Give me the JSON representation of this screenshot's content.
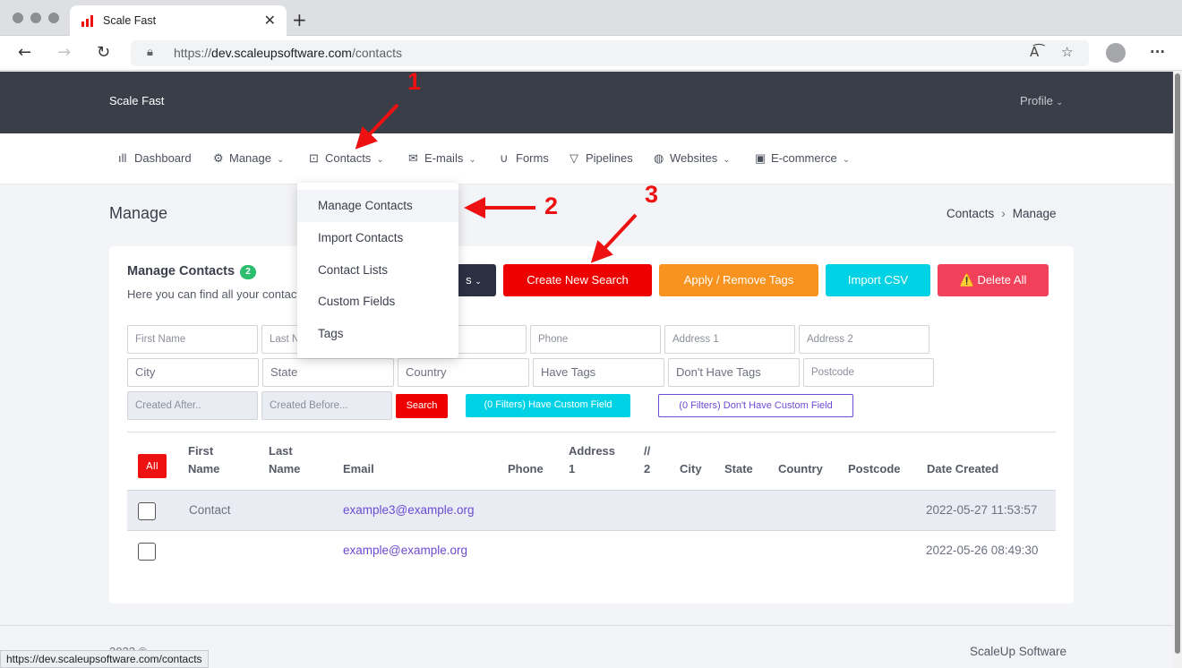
{
  "browser": {
    "tab_title": "Scale Fast",
    "url_prefix": "https://",
    "url_domain": "dev.scaleupsoftware.com",
    "url_path": "/contacts",
    "status_url": "https://dev.scaleupsoftware.com/contacts"
  },
  "header": {
    "brand": "Scale Fast",
    "profile": "Profile"
  },
  "menu": [
    {
      "label": "Dashboard",
      "icon": "bar-chart-icon"
    },
    {
      "label": "Manage",
      "icon": "gear-icon"
    },
    {
      "label": "Contacts",
      "icon": "contact-card-icon"
    },
    {
      "label": "E-mails",
      "icon": "envelope-icon"
    },
    {
      "label": "Forms",
      "icon": "magnet-icon"
    },
    {
      "label": "Pipelines",
      "icon": "funnel-icon"
    },
    {
      "label": "Websites",
      "icon": "globe-icon"
    },
    {
      "label": "E-commerce",
      "icon": "mail-box-icon"
    }
  ],
  "dropdown": [
    "Manage Contacts",
    "Import Contacts",
    "Contact Lists",
    "Custom Fields",
    "Tags"
  ],
  "page": {
    "title": "Manage",
    "breadcrumb_1": "Contacts",
    "breadcrumb_2": "Manage"
  },
  "card": {
    "title": "Manage Contacts",
    "badge": "2",
    "subtitle": "Here you can find all your contacts",
    "btn_partial": "s",
    "btn_create": "Create New Search",
    "btn_tags": "Apply / Remove Tags",
    "btn_import": "Import CSV",
    "btn_delete": "Delete All"
  },
  "filters": {
    "first_name": "First Name",
    "last_name": "Last N",
    "phone": "Phone",
    "address1": "Address 1",
    "address2": "Address 2",
    "city": "City",
    "state": "State",
    "country": "Country",
    "have_tags": "Have Tags",
    "dont_have_tags": "Don't Have Tags",
    "postcode": "Postcode",
    "created_after": "Created After..",
    "created_before": "Created Before...",
    "search": "Search",
    "have_custom": "(0 Filters) Have Custom Field",
    "dont_have_custom": "(0 Filters) Don't Have Custom Field"
  },
  "table": {
    "all": "All",
    "headers": {
      "first_a": "First",
      "first_b": "Name",
      "last_a": "Last",
      "last_b": "Name",
      "email": "Email",
      "phone": "Phone",
      "addr_a": "Address",
      "addr_b": "1",
      "addr2_a": "//",
      "addr2_b": "2",
      "city": "City",
      "state": "State",
      "country": "Country",
      "postcode": "Postcode",
      "date": "Date Created"
    },
    "rows": [
      {
        "first": "Contact",
        "email": "example3@example.org",
        "date": "2022-05-27 11:53:57"
      },
      {
        "first": "",
        "email": "example@example.org",
        "date": "2022-05-26 08:49:30"
      }
    ]
  },
  "footer": {
    "left": "2022 ©",
    "right": "ScaleUp Software"
  },
  "annotations": [
    "1",
    "2",
    "3"
  ],
  "colors": {
    "accent_red": "#ee1111",
    "orange": "#f7931e",
    "cyan": "#00d2e6",
    "pink": "#f0405a",
    "dark": "#393e49"
  }
}
